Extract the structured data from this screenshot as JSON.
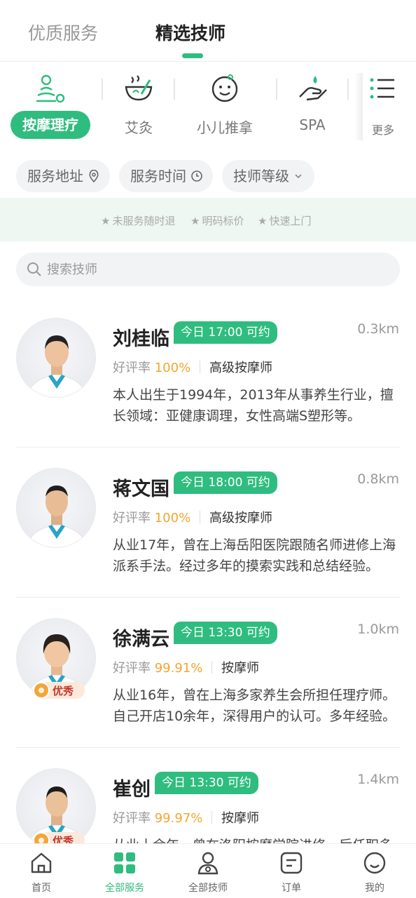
{
  "top_tabs": [
    "优质服务",
    "精选技师"
  ],
  "categories": [
    {
      "label": "按摩理疗",
      "icon": "massage-stones-icon"
    },
    {
      "label": "艾灸",
      "icon": "moxibustion-bowl-icon"
    },
    {
      "label": "小儿推拿",
      "icon": "baby-face-icon"
    },
    {
      "label": "SPA",
      "icon": "spa-hand-drop-icon"
    },
    {
      "label": "更多",
      "icon": "menu-list-icon"
    }
  ],
  "filters": [
    {
      "label": "服务地址",
      "icon": "location-pin-icon"
    },
    {
      "label": "服务时间",
      "icon": "clock-icon"
    },
    {
      "label": "技师等级",
      "icon": "chevron-down-icon"
    }
  ],
  "guarantees": [
    "未服务随时退",
    "明码标价",
    "快速上门"
  ],
  "search": {
    "placeholder": "搜索技师"
  },
  "therapists": [
    {
      "name": "刘桂临",
      "availability": "今日 17:00 可约",
      "distance": "0.3km",
      "rating_label": "好评率",
      "rating": "100%",
      "level": "高级按摩师",
      "intro": "本人出生于1994年，2013年从事养生行业，擅长领域：亚健康调理，女性高端S塑形等。",
      "badge": ""
    },
    {
      "name": "蒋文国",
      "availability": "今日 18:00 可约",
      "distance": "0.8km",
      "rating_label": "好评率",
      "rating": "100%",
      "level": "高级按摩师",
      "intro": "从业17年，曾在上海岳阳医院跟随名师进修上海派系手法。经过多年的摸索实践和总结经验。",
      "badge": ""
    },
    {
      "name": "徐满云",
      "availability": "今日 13:30 可约",
      "distance": "1.0km",
      "rating_label": "好评率",
      "rating": "99.91%",
      "level": "按摩师",
      "intro": "从业16年，曾在上海多家养生会所担任理疗师。自己开店10余年，深得用户的认可。多年经验。",
      "badge": "优秀"
    },
    {
      "name": "崔创",
      "availability": "今日 13:30 可约",
      "distance": "1.4km",
      "rating_label": "好评率",
      "rating": "99.97%",
      "level": "按摩师",
      "intro": "从业十余年，曾在洛阳按摩学院进修，后任职多家养生会所。",
      "badge": "优秀"
    }
  ],
  "bottom_nav": [
    {
      "label": "首页",
      "icon": "home-icon"
    },
    {
      "label": "全部服务",
      "icon": "grid-apps-icon"
    },
    {
      "label": "全部技师",
      "icon": "therapist-person-icon"
    },
    {
      "label": "订单",
      "icon": "order-list-icon"
    },
    {
      "label": "我的",
      "icon": "smiley-profile-icon"
    }
  ],
  "colors": {
    "accent": "#2ebd7e",
    "rating": "#f2a531",
    "guarantee_bg": "#eef7f2"
  }
}
